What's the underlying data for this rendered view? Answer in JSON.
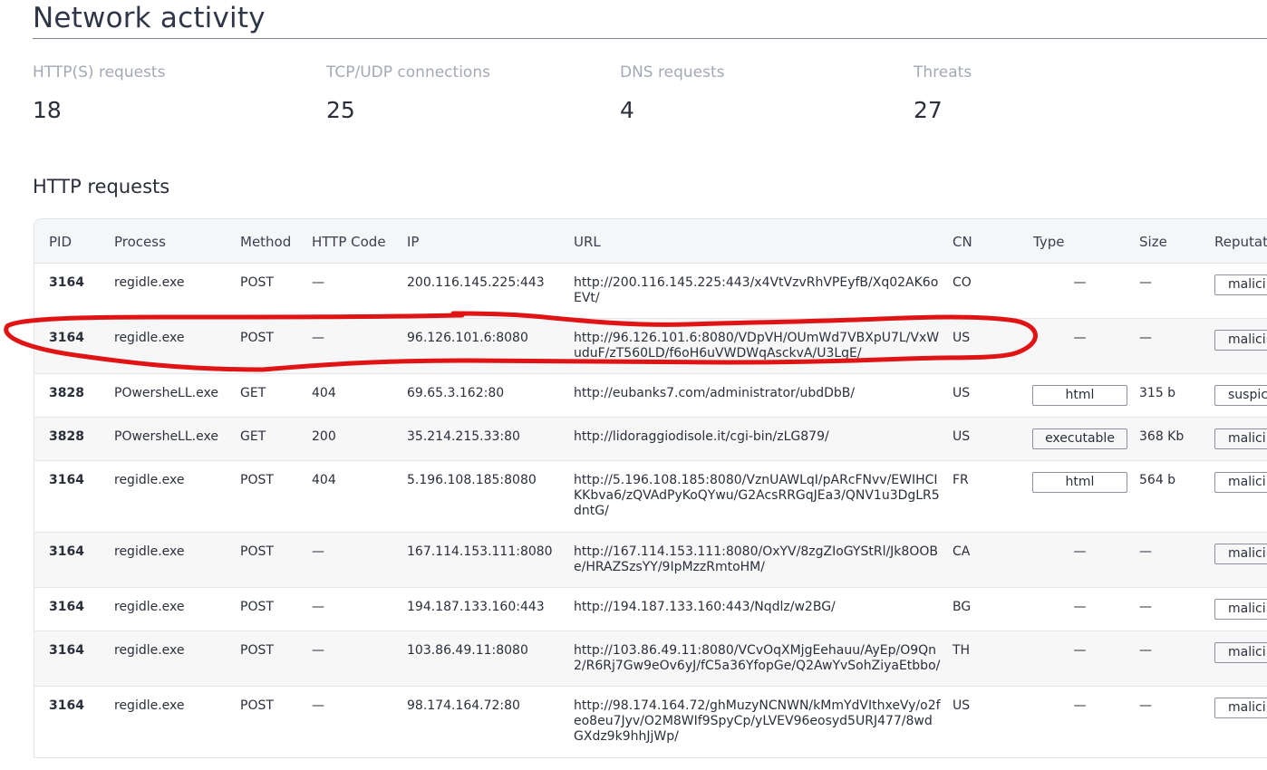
{
  "page": {
    "title": "Network activity"
  },
  "stats": [
    {
      "label": "HTTP(S) requests",
      "value": "18"
    },
    {
      "label": "TCP/UDP connections",
      "value": "25"
    },
    {
      "label": "DNS requests",
      "value": "4"
    },
    {
      "label": "Threats",
      "value": "27"
    }
  ],
  "section": {
    "title": "HTTP requests"
  },
  "table": {
    "headers": {
      "pid": "PID",
      "process": "Process",
      "method": "Method",
      "http_code": "HTTP Code",
      "ip": "IP",
      "url": "URL",
      "cn": "CN",
      "type": "Type",
      "size": "Size",
      "reputation": "Reputat"
    },
    "rows": [
      {
        "pid": "3164",
        "process": "regidle.exe",
        "method": "POST",
        "code": "—",
        "ip": "200.116.145.225:443",
        "url": "http://200.116.145.225:443/x4VtVzvRhVPEyfB/Xq02AK6oEVt/",
        "cn": "CO",
        "type": "—",
        "size": "—",
        "reputation": "malici"
      },
      {
        "pid": "3164",
        "process": "regidle.exe",
        "method": "POST",
        "code": "—",
        "ip": "96.126.101.6:8080",
        "url": "http://96.126.101.6:8080/VDpVH/OUmWd7VBXpU7L/VxWuduF/zT560LD/f6oH6uVWDWqAsckvA/U3LgE/",
        "cn": "US",
        "type": "—",
        "size": "—",
        "reputation": "malici"
      },
      {
        "pid": "3828",
        "process": "POwersheLL.exe",
        "method": "GET",
        "code": "404",
        "ip": "69.65.3.162:80",
        "url": "http://eubanks7.com/administrator/ubdDbB/",
        "cn": "US",
        "type": "html",
        "size": "315 b",
        "reputation": "suspic"
      },
      {
        "pid": "3828",
        "process": "POwersheLL.exe",
        "method": "GET",
        "code": "200",
        "ip": "35.214.215.33:80",
        "url": "http://lidoraggiodisole.it/cgi-bin/zLG879/",
        "cn": "US",
        "type": "executable",
        "size": "368 Kb",
        "reputation": "malici"
      },
      {
        "pid": "3164",
        "process": "regidle.exe",
        "method": "POST",
        "code": "404",
        "ip": "5.196.108.185:8080",
        "url": "http://5.196.108.185:8080/VznUAWLqI/pARcFNvv/EWIHCIKKbva6/zQVAdPyKoQYwu/G2AcsRRGqJEa3/QNV1u3DgLR5dntG/",
        "cn": "FR",
        "type": "html",
        "size": "564 b",
        "reputation": "malici"
      },
      {
        "pid": "3164",
        "process": "regidle.exe",
        "method": "POST",
        "code": "—",
        "ip": "167.114.153.111:8080",
        "url": "http://167.114.153.111:8080/OxYV/8zgZIoGYStRl/Jk8OOBe/HRAZSzsYY/9IpMzzRmtoHM/",
        "cn": "CA",
        "type": "—",
        "size": "—",
        "reputation": "malici"
      },
      {
        "pid": "3164",
        "process": "regidle.exe",
        "method": "POST",
        "code": "—",
        "ip": "194.187.133.160:443",
        "url": "http://194.187.133.160:443/Nqdlz/w2BG/",
        "cn": "BG",
        "type": "—",
        "size": "—",
        "reputation": "malici"
      },
      {
        "pid": "3164",
        "process": "regidle.exe",
        "method": "POST",
        "code": "—",
        "ip": "103.86.49.11:8080",
        "url": "http://103.86.49.11:8080/VCvOqXMjgEehauu/AyEp/O9Qn2/R6Rj7Gw9eOv6yJ/fC5a36YfopGe/Q2AwYvSohZiyaEtbbo/",
        "cn": "TH",
        "type": "—",
        "size": "—",
        "reputation": "malici"
      },
      {
        "pid": "3164",
        "process": "regidle.exe",
        "method": "POST",
        "code": "—",
        "ip": "98.174.164.72:80",
        "url": "http://98.174.164.72/ghMuzyNCNWN/kMmYdVIthxeVy/o2feo8eu7Jyv/O2M8WIf9SpyCp/yLVEV96eosyd5URJ477/8wdGXdz9k9hhJjWp/",
        "cn": "US",
        "type": "—",
        "size": "—",
        "reputation": "malici"
      }
    ]
  },
  "annotation": {
    "color": "#e01414"
  }
}
